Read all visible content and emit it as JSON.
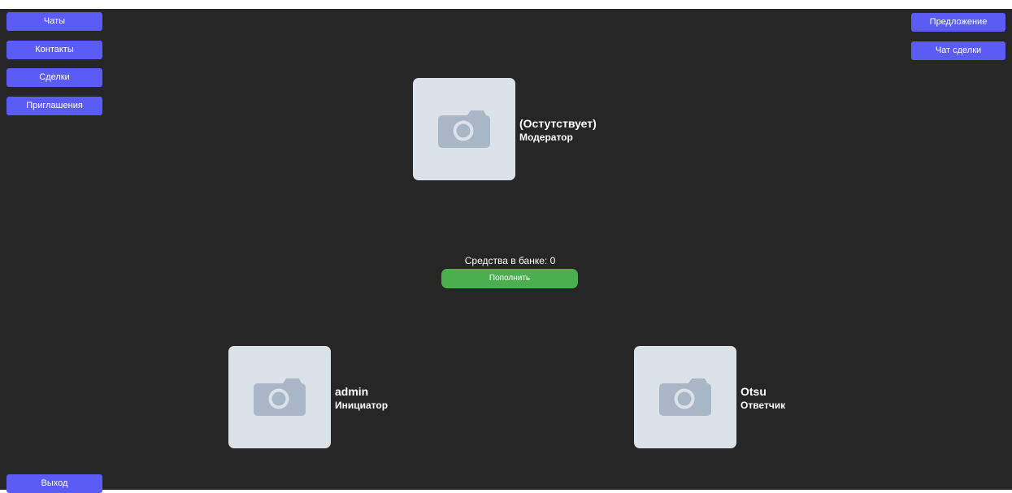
{
  "sidebar": {
    "items": [
      {
        "label": "Чаты"
      },
      {
        "label": "Контакты"
      },
      {
        "label": "Сделки"
      },
      {
        "label": "Приглашения"
      }
    ],
    "logout_label": "Выход"
  },
  "toolbar": {
    "offer_label": "Предложение",
    "deal_chat_label": "Чат сделки"
  },
  "participants": {
    "moderator": {
      "name": "(Остутствует)",
      "role": "Модератор",
      "avatar_icon": "camera-icon"
    },
    "initiator": {
      "name": "admin",
      "role": "Инициатор",
      "avatar_icon": "camera-icon"
    },
    "respondent": {
      "name": "Otsu",
      "role": "Ответчик",
      "avatar_icon": "camera-icon"
    }
  },
  "bank": {
    "label": "Средства в банке: 0",
    "topup_label": "Пополнить"
  },
  "colors": {
    "background": "#262626",
    "nav_button": "#5b5cf6",
    "topup_button": "#4caf4f",
    "avatar_bg": "#dce2ea",
    "camera_icon": "#a8b6c6"
  }
}
